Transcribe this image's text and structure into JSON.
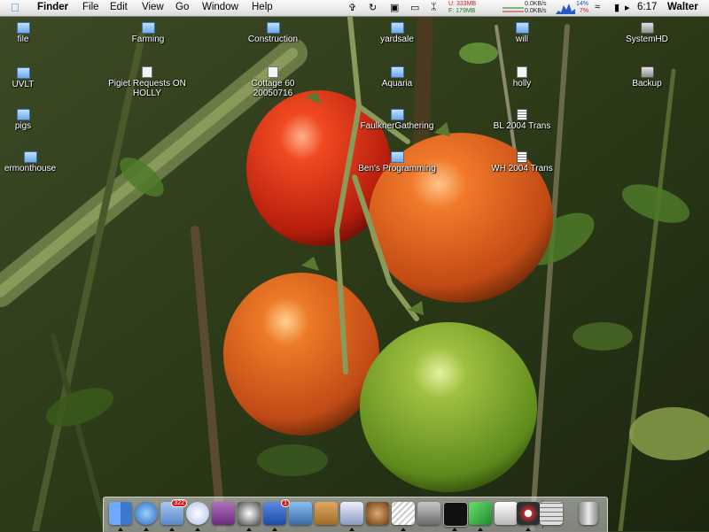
{
  "menubar": {
    "apple_icon": "apple-menu-icon",
    "app_name": "Finder",
    "menus": [
      "File",
      "Edit",
      "View",
      "Go",
      "Window",
      "Help"
    ],
    "memory": {
      "used": "U: 333MB",
      "free": "F: 179MB"
    },
    "network": {
      "in": "0.0KB/s",
      "out": "0.0KB/s"
    },
    "cpu": {
      "user": "14%",
      "system": "7%"
    },
    "clock": "6:17",
    "user": "Walter",
    "status_icons": [
      "script-icon",
      "sync-icon",
      "speakable-icon",
      "display-icon",
      "bluetooth-icon",
      "wifi-icon",
      "battery-icon",
      "volume-icon"
    ]
  },
  "desktop_icons": [
    {
      "label": "file",
      "type": "folder"
    },
    {
      "label": "UVLT",
      "type": "folder"
    },
    {
      "label": "pigs",
      "type": "folder"
    },
    {
      "label": "ermonthouse",
      "type": "folder"
    },
    {
      "label": "Farming",
      "type": "folder"
    },
    {
      "label": "Pigiet Requests ON",
      "label2": "HOLLY",
      "type": "document"
    },
    {
      "label": "Construction",
      "type": "folder"
    },
    {
      "label": "Cottage 60",
      "label2": "20050716",
      "type": "document"
    },
    {
      "label": "yardsale",
      "type": "folder"
    },
    {
      "label": "Aquaria",
      "type": "folder"
    },
    {
      "label": "FaulknerGathering",
      "type": "folder"
    },
    {
      "label": "Ben's Programming",
      "type": "folder"
    },
    {
      "label": "will",
      "type": "folder"
    },
    {
      "label": "holly",
      "type": "document"
    },
    {
      "label": "BL 2004 Trans",
      "type": "spreadsheet"
    },
    {
      "label": "WH 2004 Trans",
      "type": "spreadsheet"
    },
    {
      "label": "SystemHD",
      "type": "disk"
    },
    {
      "label": "Backup",
      "type": "disk"
    }
  ],
  "dock": {
    "items": [
      {
        "name": "finder-icon",
        "color": "#4a86d8"
      },
      {
        "name": "safari-icon",
        "color": "#3b7fd0"
      },
      {
        "name": "mail-icon",
        "color": "#7fa8d8",
        "badge": "322"
      },
      {
        "name": "itunes-icon",
        "color": "#c9d6f0"
      },
      {
        "name": "notebook-icon",
        "color": "#8a4a9a"
      },
      {
        "name": "adium-icon",
        "color": "#ffffff"
      },
      {
        "name": "ical-icon",
        "color": "#2c62c4",
        "badge": "1"
      },
      {
        "name": "iphoto-icon",
        "color": "#5a9ad8"
      },
      {
        "name": "address-book-icon",
        "color": "#c98a40"
      },
      {
        "name": "mail-client-icon",
        "color": "#d8d8e8"
      },
      {
        "name": "bug-app-icon",
        "color": "#c88a4a"
      },
      {
        "name": "script-editor-icon",
        "color": "#f0f0f0"
      },
      {
        "name": "security-icon",
        "color": "#9a9a9a"
      },
      {
        "name": "terminal-icon",
        "color": "#2a2a2a"
      },
      {
        "name": "cube-app-icon",
        "color": "#3cb84a"
      },
      {
        "name": "network-tool-icon",
        "color": "#e8e8e8"
      },
      {
        "name": "eye-app-icon",
        "color": "#404040"
      },
      {
        "name": "calculator-icon",
        "color": "#a0a0a0"
      },
      {
        "name": "trash-icon",
        "color": "#bdbdbd"
      }
    ]
  }
}
